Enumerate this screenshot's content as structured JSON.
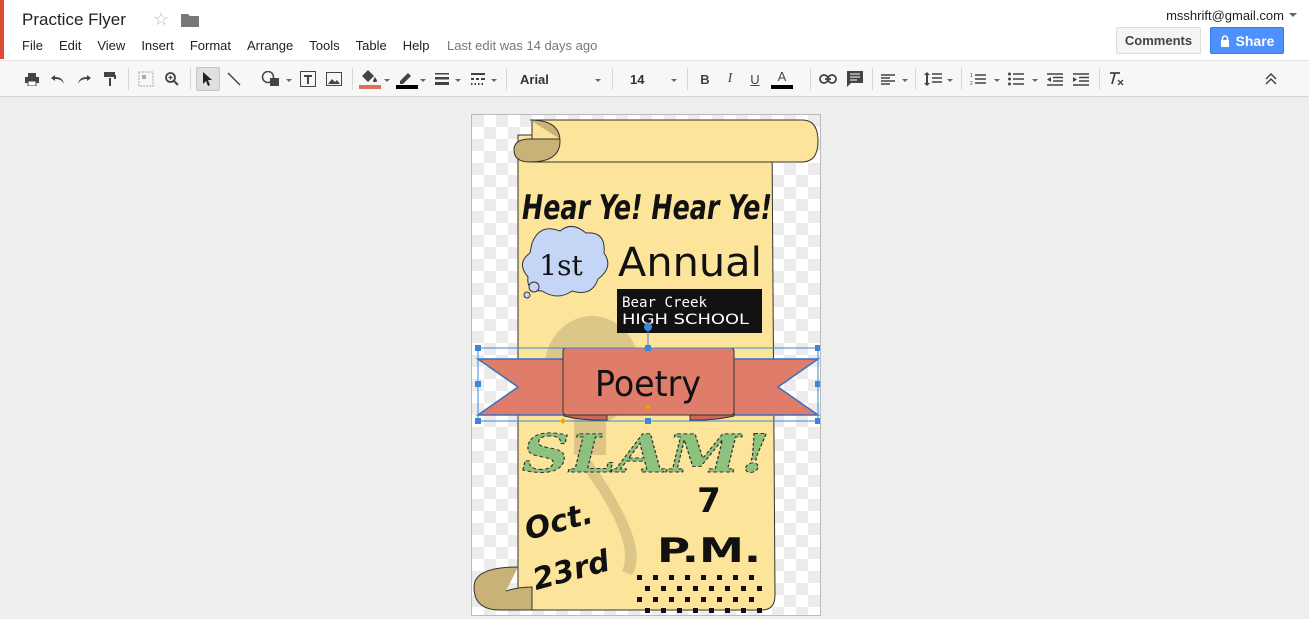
{
  "doc": {
    "title": "Practice Flyer",
    "last_edit": "Last edit was 14 days ago",
    "account": "msshrift@gmail.com"
  },
  "menu": [
    "File",
    "Edit",
    "View",
    "Insert",
    "Format",
    "Arrange",
    "Tools",
    "Table",
    "Help"
  ],
  "buttons": {
    "comments": "Comments",
    "share": "Share"
  },
  "toolbar": {
    "font": "Arial",
    "font_size": "14",
    "fill_color": "#e06c5c",
    "line_color": "#000000",
    "text_color": "#000000"
  },
  "flyer": {
    "headline": "Hear Ye! Hear Ye!",
    "badge": "1st",
    "annual": "Annual",
    "school_line1": "Bear Creek",
    "school_line2": "HIGH SCHOOL",
    "banner": "Poetry",
    "slam": "SLAM!",
    "month": "Oct.",
    "day": "23rd",
    "time_num": "7",
    "time_ampm": "P.M.",
    "scroll_color": "#fde49b",
    "banner_color": "#e07c6a",
    "cloud_color": "#c5d5f5",
    "slam_color": "#8cc27e"
  }
}
